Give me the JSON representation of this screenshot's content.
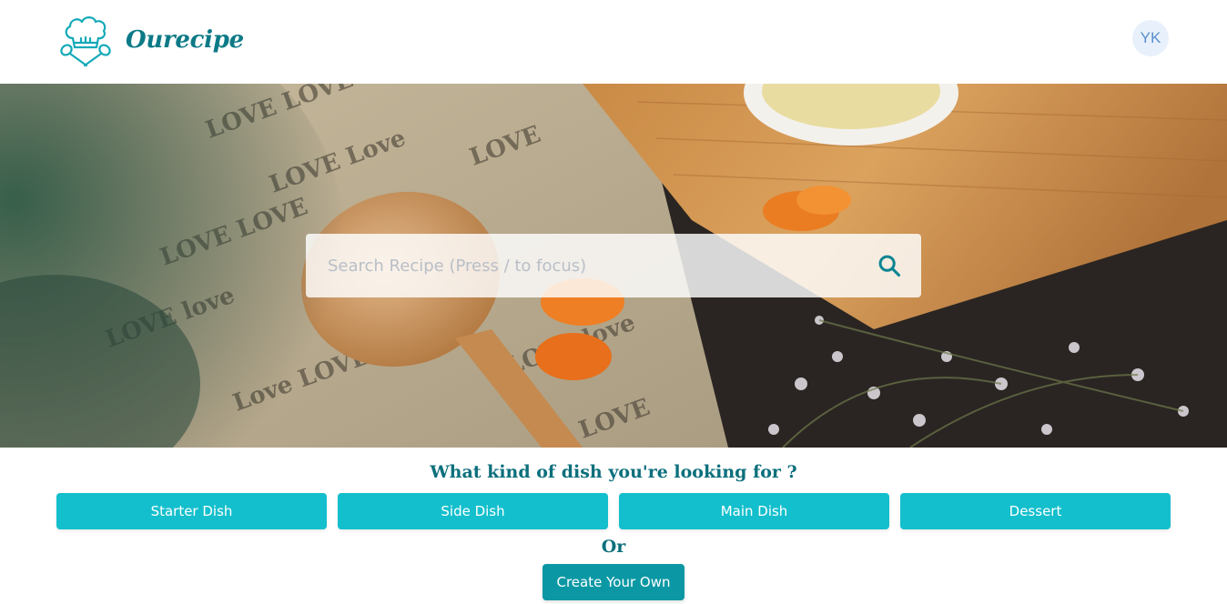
{
  "brand": {
    "name": "Ourecipe",
    "color": "#0b7a86",
    "logo_icon": "chef-hat-utensils-icon"
  },
  "user": {
    "initials": "YK"
  },
  "hero": {
    "image": "wooden-spoon-turmeric-love-cloth-photo",
    "search": {
      "placeholder": "Search Recipe (Press / to focus)",
      "value": "",
      "icon": "search-icon"
    }
  },
  "categories": {
    "question": "What kind of dish you're looking for ?",
    "items": [
      "Starter Dish",
      "Side Dish",
      "Main Dish",
      "Dessert"
    ],
    "button_color": "#14bfcd"
  },
  "alternative": {
    "or_label": "Or",
    "create_label": "Create Your Own",
    "button_color": "#0b98a4"
  }
}
